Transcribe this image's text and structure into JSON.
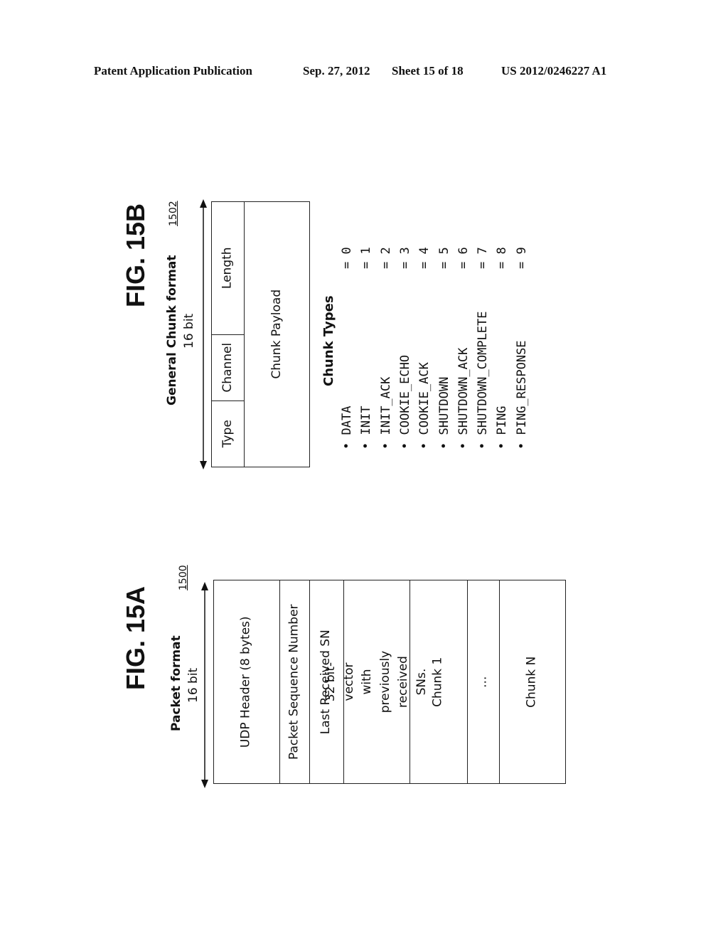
{
  "header": {
    "publication": "Patent Application Publication",
    "date": "Sep. 27, 2012",
    "sheet": "Sheet 15 of 18",
    "number": "US 2012/0246227 A1"
  },
  "fig15b": {
    "label": "FIG. 15B",
    "title": "General Chunk format",
    "width_label": "16 bit",
    "ref": "1502",
    "fields": {
      "type": "Type",
      "channel": "Channel",
      "length": "Length",
      "payload": "Chunk Payload"
    },
    "chunk_types_title": "Chunk Types",
    "chunk_types": [
      {
        "name": "DATA",
        "value": "= 0"
      },
      {
        "name": "INIT",
        "value": "= 1"
      },
      {
        "name": "INIT_ACK",
        "value": "= 2"
      },
      {
        "name": "COOKIE_ECHO",
        "value": "= 3"
      },
      {
        "name": "COOKIE_ACK",
        "value": "= 4"
      },
      {
        "name": "SHUTDOWN",
        "value": "= 5"
      },
      {
        "name": "SHUTDOWN_ACK",
        "value": "= 6"
      },
      {
        "name": "SHUTDOWN_COMPLETE",
        "value": "= 7"
      },
      {
        "name": "PING",
        "value": "= 8"
      },
      {
        "name": "PING_RESPONSE",
        "value": "= 9"
      }
    ]
  },
  "fig15a": {
    "label": "FIG. 15A",
    "title": "Packet format",
    "width_label": "16 bit",
    "ref": "1500",
    "rows": [
      "UDP Header (8 bytes)",
      "Packet Sequence Number",
      "Last Received SN",
      "32 bit-vector with previously received SNs.",
      "Chunk 1",
      "...",
      "Chunk N"
    ]
  }
}
